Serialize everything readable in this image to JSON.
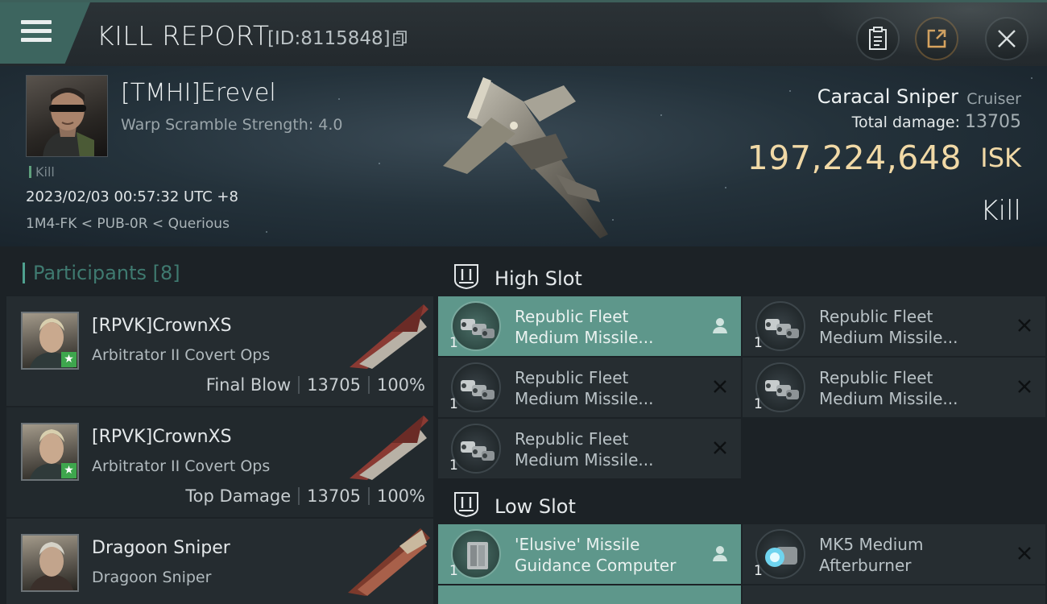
{
  "topbar": {
    "title": "KILL REPORT",
    "report_id": "[ID:8115848]",
    "menu_icon": "hamburger-icon",
    "buttons": [
      {
        "name": "clipboard",
        "icon": "clipboard-icon"
      },
      {
        "name": "share",
        "icon": "share-icon"
      },
      {
        "name": "close",
        "icon": "close-icon"
      }
    ]
  },
  "victim": {
    "name": "[TMHI]Erevel",
    "scram": "Warp Scramble Strength: 4.0",
    "kill_tag": "Kill",
    "time": "2023/02/03 00:57:32 UTC +8",
    "location": "1M4-FK < PUB-0R < Querious",
    "ship_name": "Caracal Sniper",
    "ship_class": "Cruiser",
    "damage_label": "Total damage:",
    "damage_value": "13705",
    "isk_value": "197,224,648",
    "isk_unit": "ISK",
    "result": "Kill"
  },
  "participants": {
    "title": "Participants [8]",
    "items": [
      {
        "name": "[RPVK]CrownXS",
        "ship": "Arbitrator II Covert Ops",
        "role": "Final Blow",
        "damage": "13705",
        "percent": "100%"
      },
      {
        "name": "[RPVK]CrownXS",
        "ship": "Arbitrator II Covert Ops",
        "role": "Top Damage",
        "damage": "13705",
        "percent": "100%"
      },
      {
        "name": "Dragoon Sniper",
        "ship": "Dragoon Sniper",
        "role": "",
        "damage": "",
        "percent": ""
      }
    ]
  },
  "fittings": {
    "high_slot": {
      "title": "High Slot",
      "modules": [
        {
          "name_line1": "Republic Fleet",
          "name_line2": "Medium Missile...",
          "qty": "1",
          "state": "fitted",
          "flag_icon": "person-icon"
        },
        {
          "name_line1": "Republic Fleet",
          "name_line2": "Medium Missile...",
          "qty": "1",
          "state": "destroyed",
          "flag_icon": "x-icon"
        },
        {
          "name_line1": "Republic Fleet",
          "name_line2": "Medium Missile...",
          "qty": "1",
          "state": "destroyed",
          "flag_icon": "x-icon"
        },
        {
          "name_line1": "Republic Fleet",
          "name_line2": "Medium Missile...",
          "qty": "1",
          "state": "destroyed",
          "flag_icon": "x-icon"
        },
        {
          "name_line1": "Republic Fleet",
          "name_line2": "Medium Missile...",
          "qty": "1",
          "state": "destroyed",
          "flag_icon": "x-icon"
        }
      ]
    },
    "low_slot": {
      "title": "Low Slot",
      "modules": [
        {
          "name_line1": "'Elusive' Missile",
          "name_line2": "Guidance Computer",
          "qty": "1",
          "state": "fitted",
          "flag_icon": "person-icon"
        },
        {
          "name_line1": "MK5 Medium",
          "name_line2": "Afterburner",
          "qty": "1",
          "state": "destroyed",
          "flag_icon": "x-icon"
        }
      ]
    }
  },
  "colors": {
    "accent_teal": "#5e978b",
    "isk_gold": "#f1d9a6",
    "final_blow_star": "#3ea64d"
  }
}
